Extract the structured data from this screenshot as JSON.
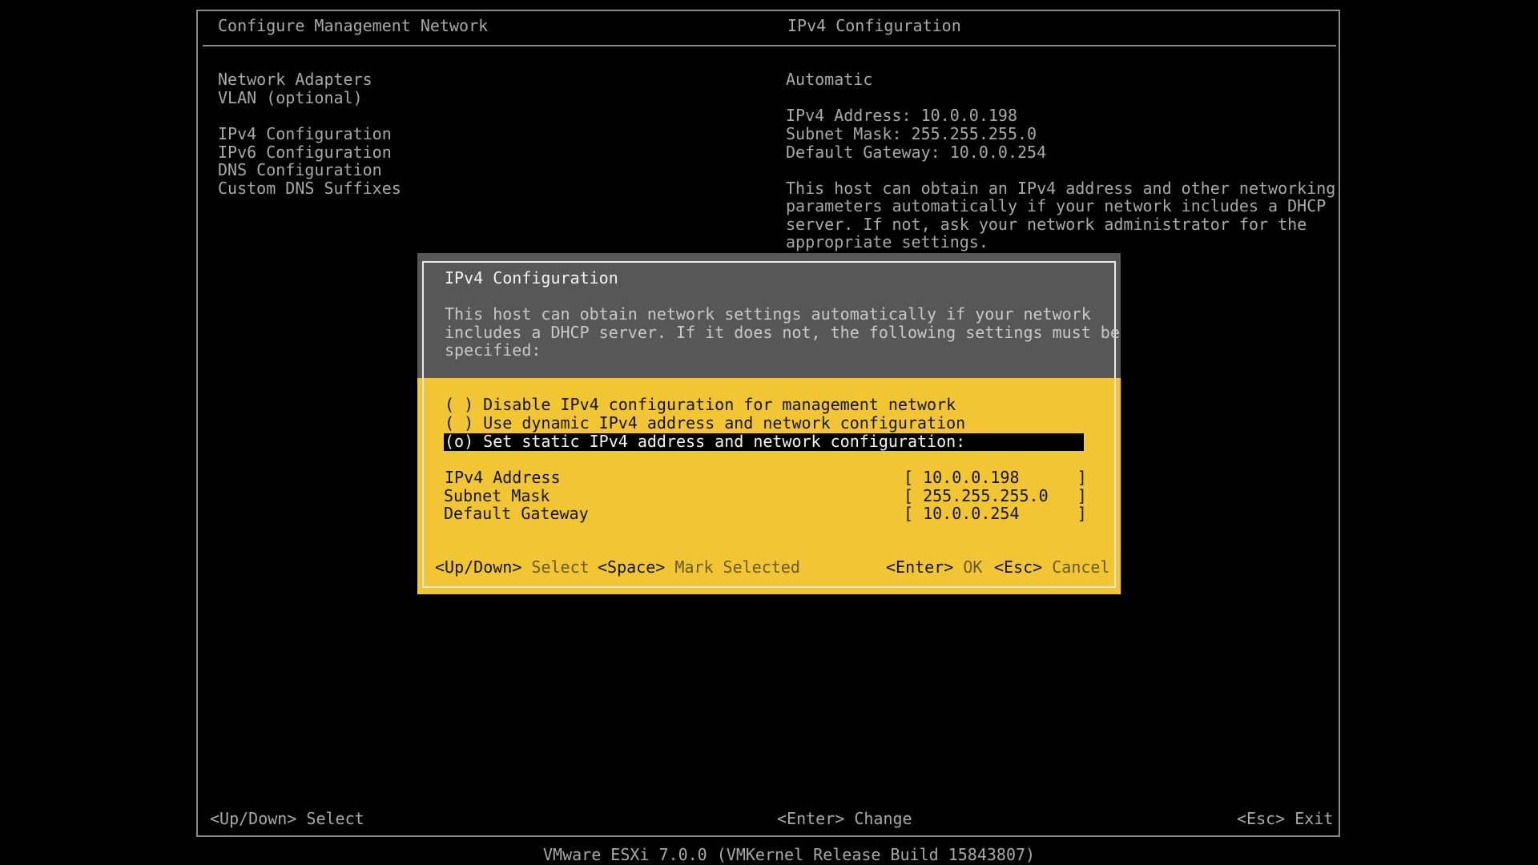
{
  "header": {
    "left_title": "Configure Management Network",
    "right_title": "IPv4 Configuration"
  },
  "menu": {
    "items": [
      "Network Adapters",
      "VLAN (optional)",
      "IPv4 Configuration",
      "IPv6 Configuration",
      "DNS Configuration",
      "Custom DNS Suffixes"
    ]
  },
  "info": {
    "mode": "Automatic",
    "ipv4_address": "IPv4 Address: 10.0.0.198",
    "subnet_mask": "Subnet Mask: 255.255.255.0",
    "default_gateway": "Default Gateway: 10.0.0.254",
    "description_lines": [
      "This host can obtain an IPv4 address and other networking",
      "parameters automatically if your network includes a DHCP",
      "server. If not, ask your network administrator for the",
      "appropriate settings."
    ]
  },
  "dialog": {
    "title": "IPv4 Configuration",
    "description_lines": [
      "This host can obtain network settings automatically if your network",
      "includes a DHCP server. If it does not, the following settings must be",
      "specified:"
    ],
    "options": [
      "( ) Disable IPv4 configuration for management network",
      "( ) Use dynamic IPv4 address and network configuration",
      "(o) Set static IPv4 address and network configuration:"
    ],
    "fields": [
      {
        "label": "IPv4 Address",
        "value": "[ 10.0.0.198      ]"
      },
      {
        "label": "Subnet Mask",
        "value": "[ 255.255.255.0   ]"
      },
      {
        "label": "Default Gateway",
        "value": "[ 10.0.0.254      ]"
      }
    ],
    "footer": {
      "updown_key": "<Up/Down>",
      "updown_action": "Select",
      "space_key": "<Space>",
      "space_action": "Mark Selected",
      "enter_key": "<Enter>",
      "enter_action": "OK",
      "esc_key": "<Esc>",
      "esc_action": "Cancel"
    }
  },
  "footer": {
    "select_hint": "<Up/Down> Select",
    "change_hint": "<Enter> Change",
    "exit_hint": "<Esc> Exit"
  },
  "version": "VMware ESXi 7.0.0 (VMKernel Release Build 15843807)",
  "colors": {
    "background": "#000000",
    "dialog_yellow": "#f1c534",
    "dialog_gray": "#575757",
    "text_gray": "#a8a8a8"
  }
}
